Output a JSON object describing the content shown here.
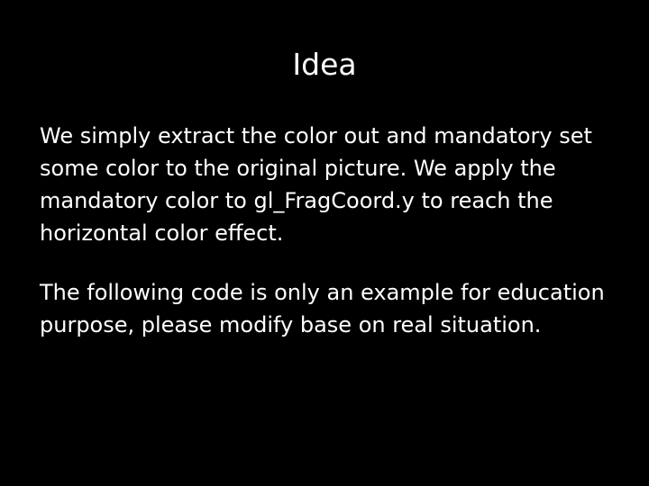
{
  "slide": {
    "title": "Idea",
    "paragraphs": [
      "We simply extract the color out and mandatory set some color to the original picture. We apply the mandatory color to gl_FragCoord.y to reach the horizontal color effect.",
      "The following code is only an example for education purpose, please modify base on real situation."
    ]
  }
}
